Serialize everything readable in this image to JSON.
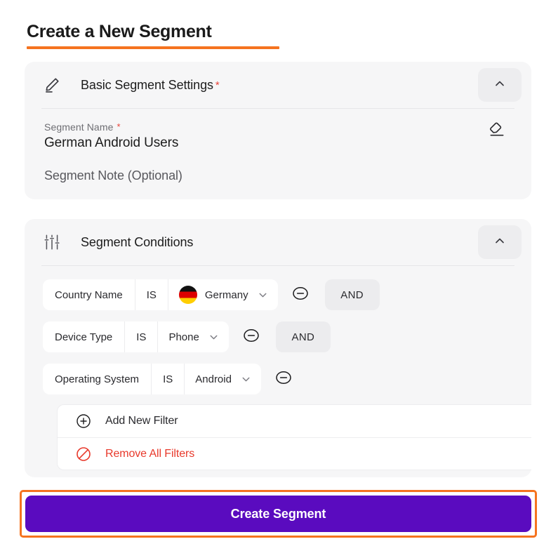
{
  "page": {
    "title": "Create a New Segment",
    "accent_orange": "#F5731F",
    "accent_purple": "#5A0BBF",
    "danger_red": "#E8392B"
  },
  "basic_settings": {
    "header_title": "Basic Segment Settings",
    "header_required_mark": "*",
    "header_icon": "pencil-icon",
    "collapse_icon": "chevron-up-icon",
    "name_label": "Segment Name",
    "name_required_mark": "*",
    "name_value": "German Android Users",
    "clear_icon": "eraser-icon",
    "note_placeholder": "Segment Note (Optional)"
  },
  "segment_conditions": {
    "header_title": "Segment Conditions",
    "header_icon": "sliders-icon",
    "collapse_icon": "chevron-up-icon",
    "filters": [
      {
        "attribute": "Country Name",
        "operator": "IS",
        "value": "Germany",
        "value_flag": "germany-flag-icon",
        "remove_icon": "minus-circle-icon",
        "connector": "AND"
      },
      {
        "attribute": "Device Type",
        "operator": "IS",
        "value": "Phone",
        "value_flag": null,
        "remove_icon": "minus-circle-icon",
        "connector": "AND"
      },
      {
        "attribute": "Operating System",
        "operator": "IS",
        "value": "Android",
        "value_flag": null,
        "remove_icon": "minus-circle-icon",
        "connector": null
      }
    ],
    "actions": [
      {
        "label": "Add New Filter",
        "icon": "plus-circle-icon",
        "style": "normal"
      },
      {
        "label": "Remove All Filters",
        "icon": "ban-icon",
        "style": "danger"
      }
    ]
  },
  "cta": {
    "label": "Create Segment"
  }
}
